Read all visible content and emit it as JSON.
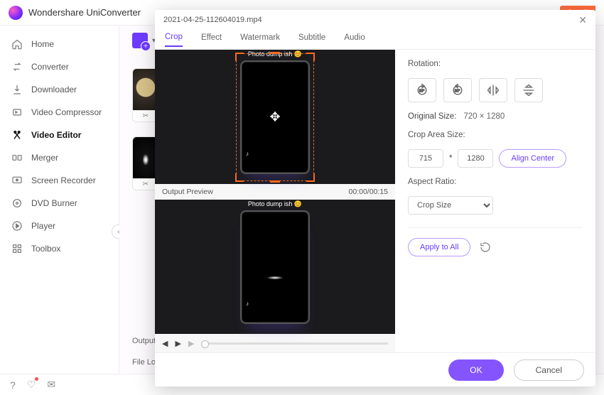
{
  "app": {
    "title": "Wondershare UniConverter",
    "promo_tag": "See P"
  },
  "sidebar": {
    "items": [
      {
        "label": "Home",
        "icon": "home-icon"
      },
      {
        "label": "Converter",
        "icon": "converter-icon"
      },
      {
        "label": "Downloader",
        "icon": "downloader-icon"
      },
      {
        "label": "Video Compressor",
        "icon": "compressor-icon"
      },
      {
        "label": "Video Editor",
        "icon": "editor-icon"
      },
      {
        "label": "Merger",
        "icon": "merger-icon"
      },
      {
        "label": "Screen Recorder",
        "icon": "recorder-icon"
      },
      {
        "label": "DVD Burner",
        "icon": "dvd-icon"
      },
      {
        "label": "Player",
        "icon": "player-icon"
      },
      {
        "label": "Toolbox",
        "icon": "toolbox-icon"
      }
    ],
    "active_index": 4
  },
  "bottom": {
    "output_label": "Output F",
    "location_label": "File Loca"
  },
  "modal": {
    "filename": "2021-04-25-112604019.mp4",
    "tabs": [
      "Crop",
      "Effect",
      "Watermark",
      "Subtitle",
      "Audio"
    ],
    "active_tab": 0,
    "preview_label": "Output Preview",
    "time_current": "00:00",
    "time_total": "00:15",
    "phone_caption": "Photo dump ish",
    "rotation_label": "Rotation:",
    "original_size_label": "Original Size:",
    "original_size_value": "720 × 1280",
    "crop_area_label": "Crop Area Size:",
    "crop_w": "715",
    "crop_mul": "*",
    "crop_h": "1280",
    "align_center_label": "Align Center",
    "aspect_label": "Aspect Ratio:",
    "aspect_value": "Crop Size",
    "apply_all_label": "Apply to All",
    "ok_label": "OK",
    "cancel_label": "Cancel"
  }
}
